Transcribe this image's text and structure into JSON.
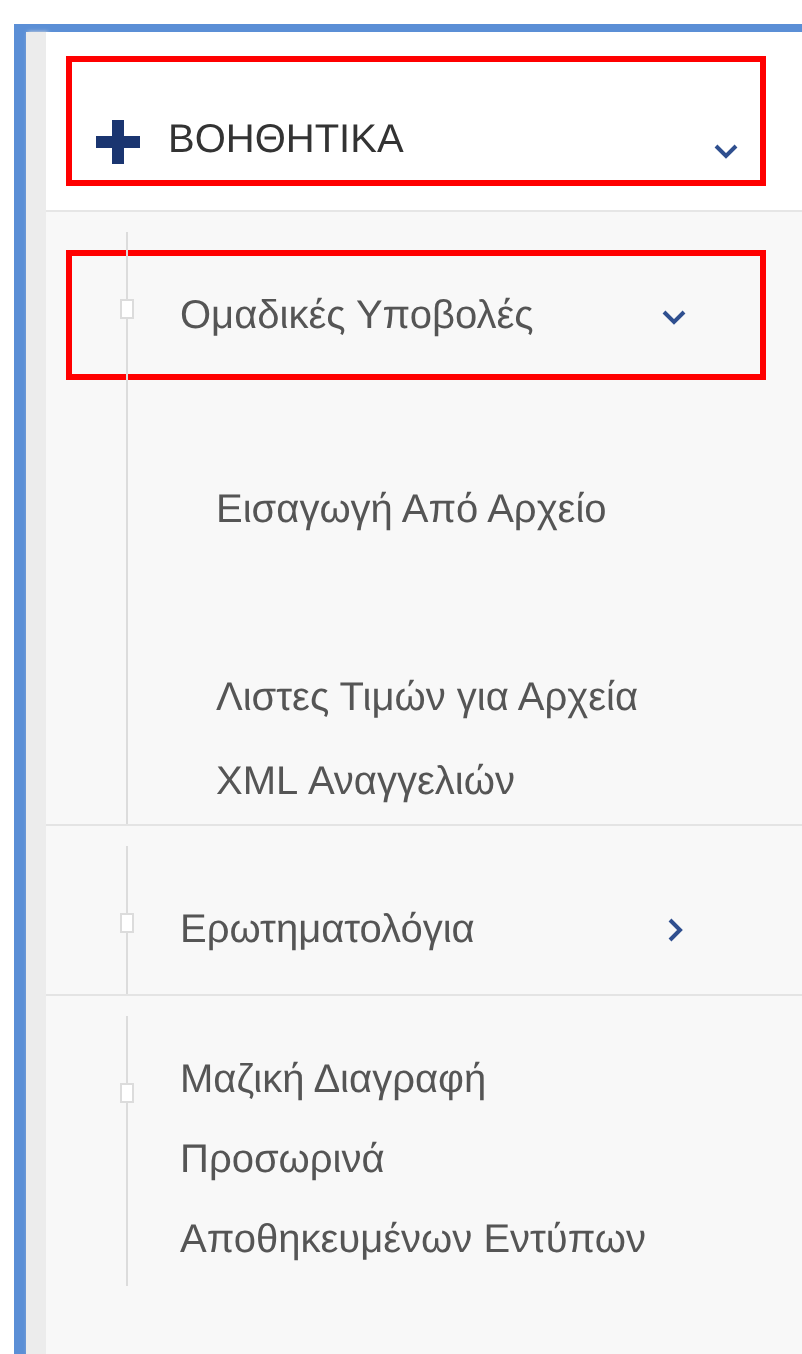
{
  "menu": {
    "label": "ΒΟΗΘΗΤΙΚΑ",
    "expanded": true,
    "highlighted": true,
    "children": [
      {
        "label": "Ομαδικές Υποβολές",
        "expanded": true,
        "highlighted": true,
        "children": [
          {
            "label": "Εισαγωγή Από Αρχείο"
          },
          {
            "label": "Λιστες Τιμών για Αρχεία XML Αναγγελιών"
          }
        ]
      },
      {
        "label": "Ερωτηματολόγια",
        "expanded": false,
        "highlighted": false
      },
      {
        "label": "Μαζική Διαγραφή Προσωρινά Αποθηκευμένων Εντύπων",
        "highlighted": false
      }
    ]
  }
}
